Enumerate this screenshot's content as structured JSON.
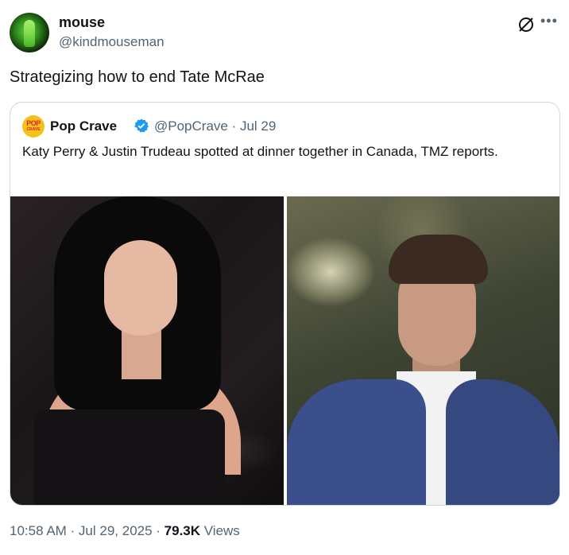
{
  "post": {
    "author_name": "mouse",
    "author_handle": "@kindmouseman",
    "text": "Strategizing how to end Tate McRae",
    "more_icon": "more-horizontal-icon",
    "grok_icon": "grok-icon"
  },
  "quote": {
    "avatar_line1": "POP",
    "avatar_line2": "CRAVE",
    "author_name": "Pop Crave",
    "verified": "verified-badge-icon",
    "meta": "@PopCrave · Jul 29",
    "text": "Katy Perry & Justin Trudeau spotted at dinner together in Canada, TMZ reports.",
    "colors": {
      "verified": "#1d9bf0",
      "avatar_bg": "#f4c21a",
      "avatar_text": "#d7262f"
    }
  },
  "footer": {
    "time": "10:58 AM · Jul 29, 2025 · ",
    "views_count": "79.3K",
    "views_label": " Views"
  }
}
